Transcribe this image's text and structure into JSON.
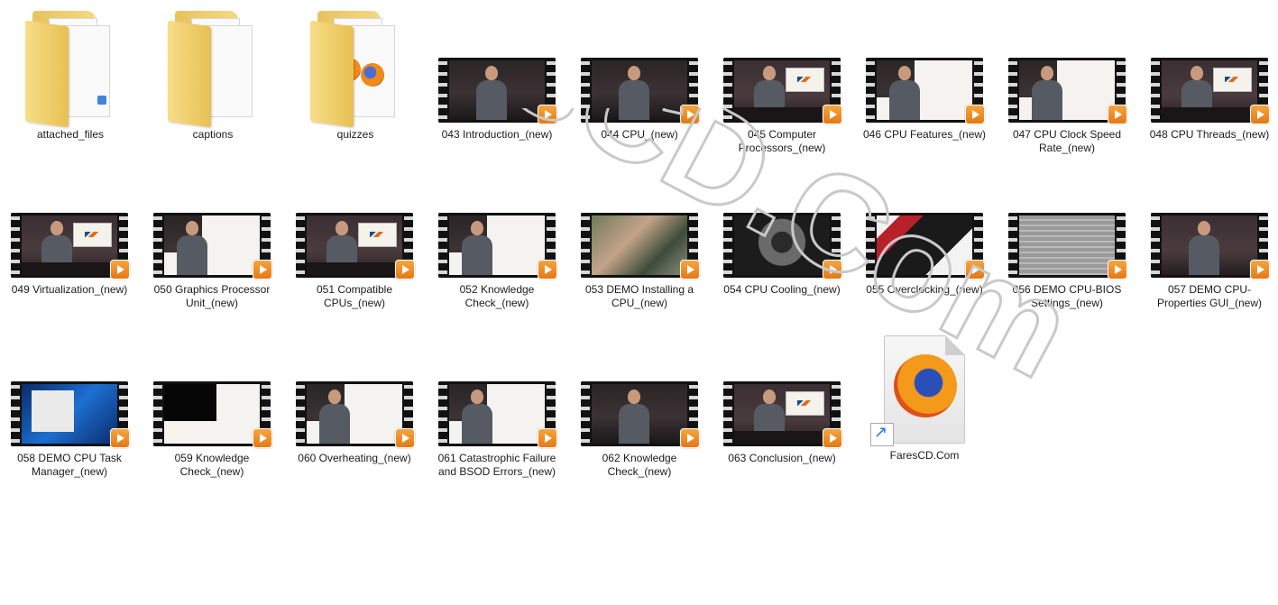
{
  "folders": [
    {
      "label": "attached_files"
    },
    {
      "label": "captions"
    },
    {
      "label": "quizzes"
    }
  ],
  "videos": [
    {
      "label": "043 Introduction_(new)"
    },
    {
      "label": "044 CPU_(new)"
    },
    {
      "label": "045 Computer Processors_(new)"
    },
    {
      "label": "046 CPU Features_(new)"
    },
    {
      "label": "047 CPU Clock Speed Rate_(new)"
    },
    {
      "label": "048 CPU Threads_(new)"
    },
    {
      "label": "049 Virtualization_(new)"
    },
    {
      "label": "050 Graphics Processor Unit_(new)"
    },
    {
      "label": "051 Compatible CPUs_(new)"
    },
    {
      "label": "052 Knowledge Check_(new)"
    },
    {
      "label": "053 DEMO Installing a CPU_(new)"
    },
    {
      "label": "054 CPU Cooling_(new)"
    },
    {
      "label": "055 Overclocking_(new)"
    },
    {
      "label": "056 DEMO CPU-BIOS Settings_(new)"
    },
    {
      "label": "057 DEMO CPU-Properties GUI_(new)"
    },
    {
      "label": "058 DEMO CPU Task Manager_(new)"
    },
    {
      "label": "059 Knowledge Check_(new)"
    },
    {
      "label": "060 Overheating_(new)"
    },
    {
      "label": "061 Catastrophic Failure and BSOD Errors_(new)"
    },
    {
      "label": "062 Knowledge Check_(new)"
    },
    {
      "label": "063 Conclusion_(new)"
    }
  ],
  "shortcut": {
    "label": "FaresCD.Com",
    "icon": "firefox-icon"
  },
  "watermark": {
    "text": "FaresCD.Com"
  }
}
